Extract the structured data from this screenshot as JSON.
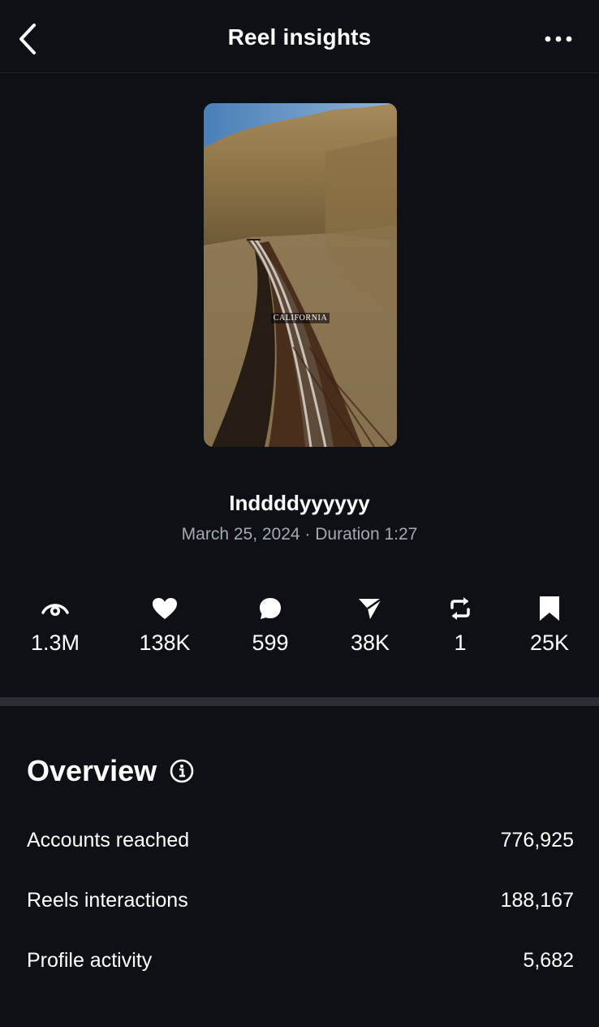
{
  "header": {
    "title": "Reel insights",
    "back_icon": "chevron-left-icon",
    "more_icon": "more-horizontal-icon"
  },
  "thumbnail": {
    "caption": "CALIFORNIA"
  },
  "reel": {
    "title": "Inddddyyyyyy",
    "meta": "March 25, 2024 · Duration 1:27"
  },
  "stats": [
    {
      "icon": "eye-icon",
      "value": "1.3M"
    },
    {
      "icon": "heart-icon",
      "value": "138K"
    },
    {
      "icon": "comment-icon",
      "value": "599"
    },
    {
      "icon": "share-icon",
      "value": "38K"
    },
    {
      "icon": "repost-icon",
      "value": "1"
    },
    {
      "icon": "bookmark-icon",
      "value": "25K"
    }
  ],
  "overview": {
    "title": "Overview",
    "metrics": [
      {
        "label": "Accounts reached",
        "value": "776,925"
      },
      {
        "label": "Reels interactions",
        "value": "188,167"
      },
      {
        "label": "Profile activity",
        "value": "5,682"
      }
    ]
  },
  "colors": {
    "background": "#0d1015",
    "secondary_text": "#a4a8b0",
    "divider": "#2b2f35"
  }
}
